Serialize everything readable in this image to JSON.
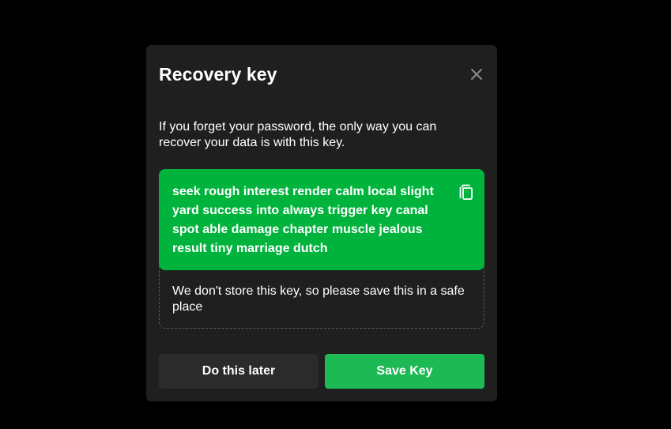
{
  "dialog": {
    "title": "Recovery key",
    "close_icon": "close-icon",
    "description": "If you forget your password, the only way you can recover your data is with this key.",
    "recovery_key": "seek rough interest render calm local slight yard success into always trigger key canal spot able damage chapter muscle jealous result tiny marriage dutch",
    "copy_icon": "copy-icon",
    "warning": "We don't store this key, so please save this in a safe place",
    "buttons": {
      "later_label": "Do this later",
      "save_label": "Save Key"
    }
  },
  "colors": {
    "background": "#000000",
    "dialog": "#1f1f1f",
    "key_box": "#00b33c",
    "primary_button": "#1db954",
    "secondary_button": "#2b2b2b",
    "text": "#ffffff"
  }
}
